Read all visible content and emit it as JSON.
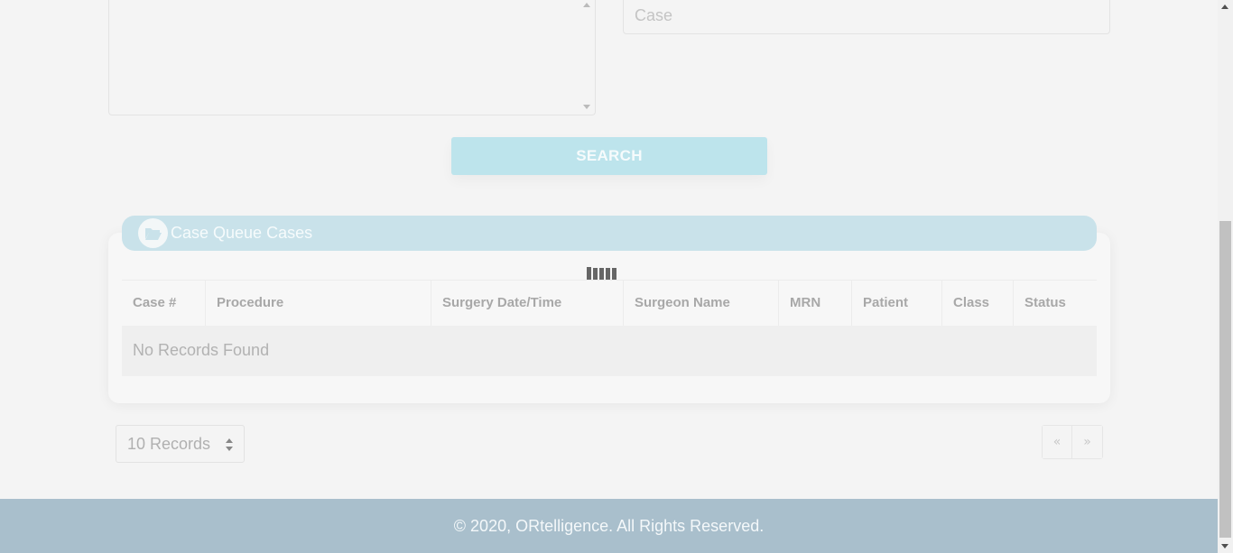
{
  "form": {
    "case_placeholder": "Case",
    "search_label": "SEARCH"
  },
  "card": {
    "title": "Case Queue Cases",
    "icon": "folder-open-icon"
  },
  "table": {
    "columns": [
      "Case #",
      "Procedure",
      "Surgery Date/Time",
      "Surgeon Name",
      "MRN",
      "Patient",
      "Class",
      "Status"
    ],
    "empty_message": "No Records Found"
  },
  "pagination": {
    "page_size_label": "10 Records",
    "prev_label": "«",
    "next_label": "»"
  },
  "footer": {
    "copyright": "© 2020, ORtelligence. All Rights Reserved."
  },
  "colors": {
    "accent": "#bde4ec",
    "header_bar": "#c9e2ea",
    "footer_bg": "#a9bfcc"
  }
}
